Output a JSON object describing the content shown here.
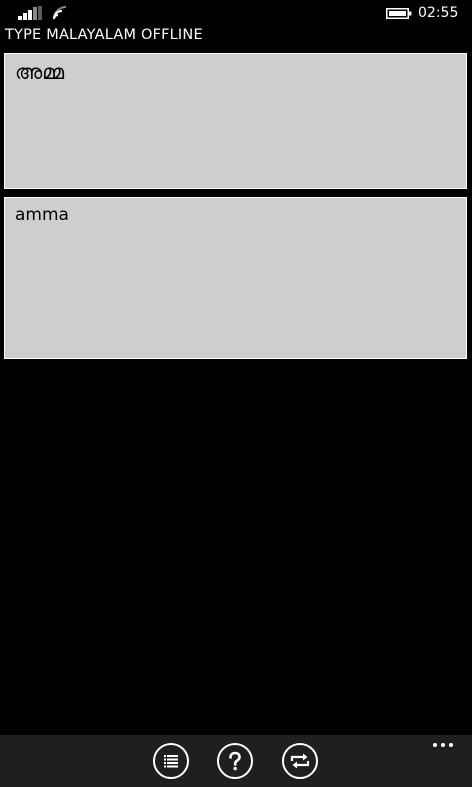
{
  "status_bar": {
    "time": "02:55",
    "icons": [
      "signal-icon",
      "wifi-icon",
      "battery-icon"
    ]
  },
  "app": {
    "title": "TYPE MALAYALAM OFFLINE"
  },
  "output_box": {
    "value": "അമ്മ"
  },
  "input_box": {
    "value": "amma"
  },
  "app_bar": {
    "buttons": [
      {
        "icon": "list-icon"
      },
      {
        "icon": "help-icon"
      },
      {
        "icon": "swap-icon"
      }
    ],
    "more_icon": "ellipsis-icon"
  },
  "colors": {
    "background": "#000000",
    "text_box": "#cecece",
    "app_bar": "#1f1f1f",
    "foreground": "#ffffff"
  }
}
